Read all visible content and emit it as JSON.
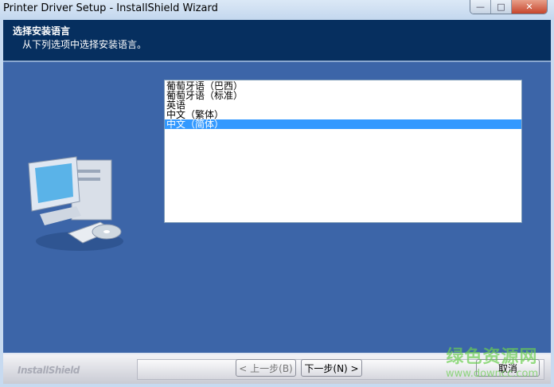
{
  "window": {
    "title": "Printer Driver Setup - InstallShield Wizard",
    "minimize": "—",
    "maximize": "□",
    "close": "✕"
  },
  "header": {
    "title": "选择安装语言",
    "subtitle": "从下列选项中选择安装语言。"
  },
  "languages": {
    "items": [
      "葡萄牙语（巴西）",
      "葡萄牙语（标准）",
      "英语",
      "中文（繁体）",
      "中文（简体）"
    ],
    "selected": "中文（简体）"
  },
  "footer": {
    "logo": "InstallShield",
    "back": "< 上一步(B)",
    "next": "下一步(N) >",
    "cancel": "取消"
  },
  "watermark": {
    "line1": "绿色资源网",
    "line2": "www.downcc.com"
  }
}
